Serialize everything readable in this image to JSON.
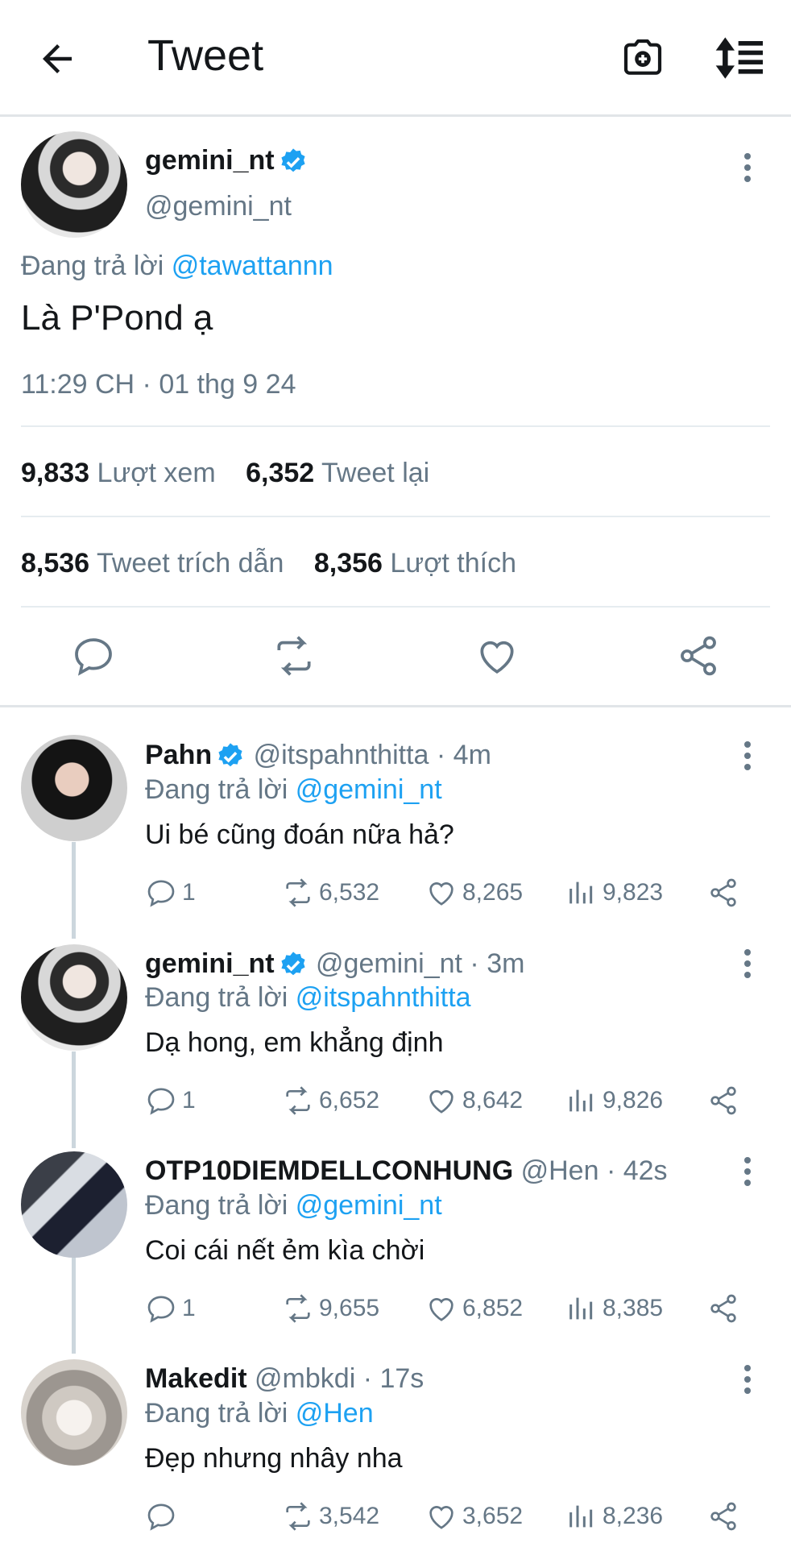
{
  "header": {
    "title": "Tweet"
  },
  "main_tweet": {
    "display_name": "gemini_nt",
    "handle": "@gemini_nt",
    "replying_prefix": "Đang trả lời",
    "replying_to": "@tawattannn",
    "text": "Là P'Pond ạ",
    "timestamp": "11:29 CH · 01 thg 9 24",
    "stats": {
      "views_count": "9,833",
      "views_label": "Lượt xem",
      "retweets_count": "6,352",
      "retweets_label": "Tweet lại",
      "quotes_count": "8,536",
      "quotes_label": "Tweet trích dẫn",
      "likes_count": "8,356",
      "likes_label": "Lượt thích"
    }
  },
  "replies": [
    {
      "display_name": "Pahn",
      "handle": "@itspahnthitta",
      "time": "· 4m",
      "replying_prefix": "Đang trả lời",
      "replying_to": "@gemini_nt",
      "text": "Ui bé cũng đoán nữa hả?",
      "reply_count": "1",
      "retweet_count": "6,532",
      "like_count": "8,265",
      "view_count": "9,823",
      "verified": true
    },
    {
      "display_name": "gemini_nt",
      "handle": "@gemini_nt",
      "time": "· 3m",
      "replying_prefix": "Đang trả lời",
      "replying_to": "@itspahnthitta",
      "text": "Dạ hong, em khẳng định",
      "reply_count": "1",
      "retweet_count": "6,652",
      "like_count": "8,642",
      "view_count": "9,826",
      "verified": true
    },
    {
      "display_name": "OTP10DIEMDELLCONHUNG",
      "handle": "@Hen",
      "time": "· 42s",
      "replying_prefix": "Đang trả lời",
      "replying_to": "@gemini_nt",
      "text": "Coi cái nết ẻm kìa chời",
      "reply_count": "1",
      "retweet_count": "9,655",
      "like_count": "6,852",
      "view_count": "8,385",
      "verified": false
    },
    {
      "display_name": "Makedit",
      "handle": "@mbkdi",
      "time": "· 17s",
      "replying_prefix": "Đang trả lời",
      "replying_to": "@Hen",
      "text": "Đẹp nhưng nhây nha",
      "reply_count": "",
      "retweet_count": "3,542",
      "like_count": "3,652",
      "view_count": "8,236",
      "verified": false
    }
  ],
  "colors": {
    "accent": "#1da1f2",
    "secondary_text": "#657786",
    "primary_text": "#14171a",
    "divider": "#e6ecf0"
  }
}
